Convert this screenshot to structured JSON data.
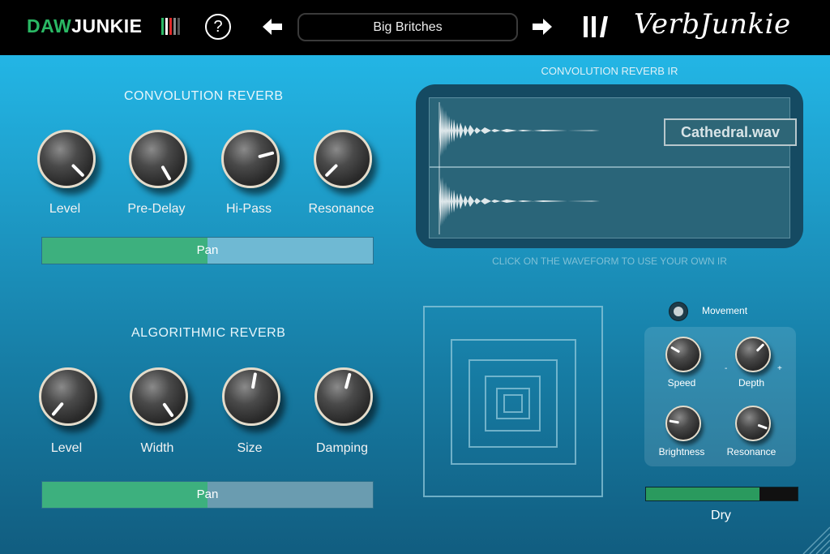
{
  "header": {
    "logo_left": "DAW",
    "logo_right": "JUNKIE",
    "help_symbol": "?",
    "preset_name": "Big Britches",
    "brand": "VerbJunkie",
    "icons": [
      "help-icon",
      "arrow-left-icon",
      "arrow-right-icon",
      "menu-icon"
    ]
  },
  "convolution": {
    "title": "CONVOLUTION REVERB",
    "knobs": [
      {
        "label": "Level",
        "angle": 135
      },
      {
        "label": "Pre-Delay",
        "angle": 150
      },
      {
        "label": "Hi-Pass",
        "angle": 75
      },
      {
        "label": "Resonance",
        "angle": -135
      }
    ],
    "pan_label": "Pan",
    "pan_value": 0.5
  },
  "algorithmic": {
    "title": "ALGORITHMIC REVERB",
    "knobs": [
      {
        "label": "Level",
        "angle": -140
      },
      {
        "label": "Width",
        "angle": 145
      },
      {
        "label": "Size",
        "angle": 10
      },
      {
        "label": "Damping",
        "angle": 15
      }
    ],
    "pan_label": "Pan",
    "pan_value": 0.5
  },
  "ir": {
    "title": "CONVOLUTION REVERB IR",
    "file": "Cathedral.wav",
    "hint": "CLICK ON THE WAVEFORM TO USE YOUR OWN IR"
  },
  "modulation": {
    "movement_label": "Movement",
    "minus": "-",
    "plus": "+",
    "knobs": [
      {
        "label": "Speed",
        "angle": -60
      },
      {
        "label": "Depth",
        "angle": 45
      },
      {
        "label": "Brightness",
        "angle": -80
      },
      {
        "label": "Resonance",
        "angle": 110
      }
    ]
  },
  "dry": {
    "label": "Dry",
    "value": 0.75
  },
  "colors": {
    "pan_fill": "#3db07e",
    "pan_track": "#6fb9d3",
    "pan_track_alt": "#6a9cb0",
    "accent_green": "#2ab864"
  }
}
